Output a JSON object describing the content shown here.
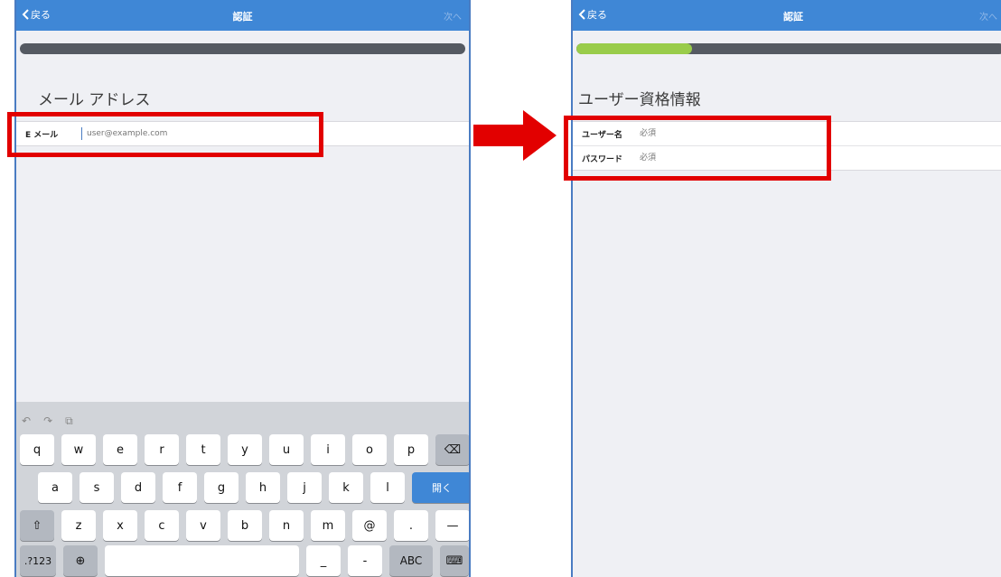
{
  "left": {
    "nav": {
      "back": "戻る",
      "title": "認証",
      "next": "次へ"
    },
    "progress": 0,
    "section_title": "メール アドレス",
    "email_label": "E メール",
    "email_placeholder": "user@example.com",
    "toolbar_icons": [
      "undo-icon",
      "redo-icon",
      "paste-icon"
    ],
    "keyboard": {
      "row1": [
        "q",
        "w",
        "e",
        "r",
        "t",
        "y",
        "u",
        "i",
        "o",
        "p"
      ],
      "row2": [
        "a",
        "s",
        "d",
        "f",
        "g",
        "h",
        "j",
        "k",
        "l"
      ],
      "open_key": "開く",
      "row3": [
        "z",
        "x",
        "c",
        "v",
        "b",
        "n",
        "m",
        "@",
        ".",
        "—"
      ],
      "numbers_key": ".?123",
      "underscore": "_",
      "dash": "-",
      "abc_key": "ABC"
    }
  },
  "right": {
    "nav": {
      "back": "戻る",
      "title": "認証",
      "next": "次へ"
    },
    "progress": 0.27,
    "section_title": "ユーザー資格情報",
    "username_label": "ユーザー名",
    "username_placeholder": "必須",
    "password_label": "パスワード",
    "password_placeholder": "必須"
  },
  "colors": {
    "accent": "#3f87d6",
    "highlight": "#e20000",
    "progress": "#99cc4a"
  }
}
